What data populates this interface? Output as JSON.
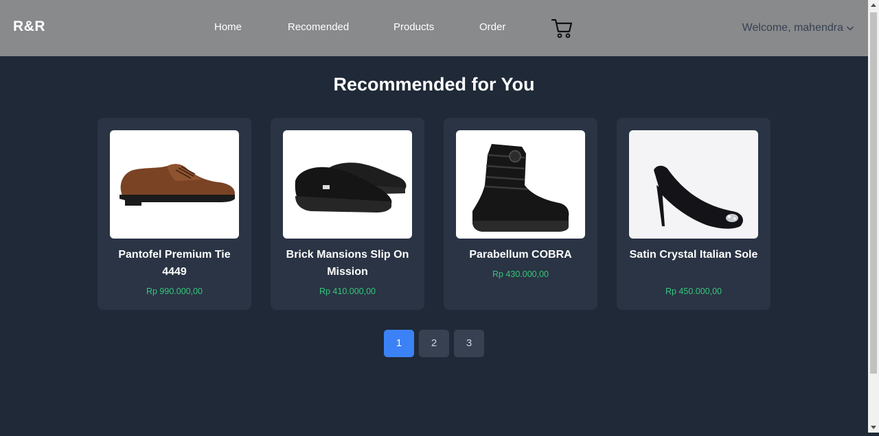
{
  "navbar": {
    "brand": "R&R",
    "links": [
      "Home",
      "Recomended",
      "Products",
      "Order"
    ],
    "cart_icon": "shopping-cart-icon",
    "welcome": "Welcome, mahendra",
    "welcome_icon": "chevron-down-icon"
  },
  "main": {
    "title": "Recommended for You",
    "products": [
      {
        "name": "Pantofel Premium Tie 4449",
        "price": "Rp 990.000,00"
      },
      {
        "name": "Brick Mansions Slip On Mission",
        "price": "Rp 410.000,00"
      },
      {
        "name": "Parabellum COBRA",
        "price": "Rp 430.000,00"
      },
      {
        "name": "Satin Crystal Italian Sole",
        "price": "Rp 450.000,00"
      }
    ],
    "pagination": [
      "1",
      "2",
      "3"
    ],
    "active_page": "1"
  },
  "colors": {
    "navbar_bg": "#898a8c",
    "page_bg": "#1f2937",
    "card_bg": "#2a3444",
    "price": "#34c77b",
    "active_page": "#3b82f6"
  }
}
